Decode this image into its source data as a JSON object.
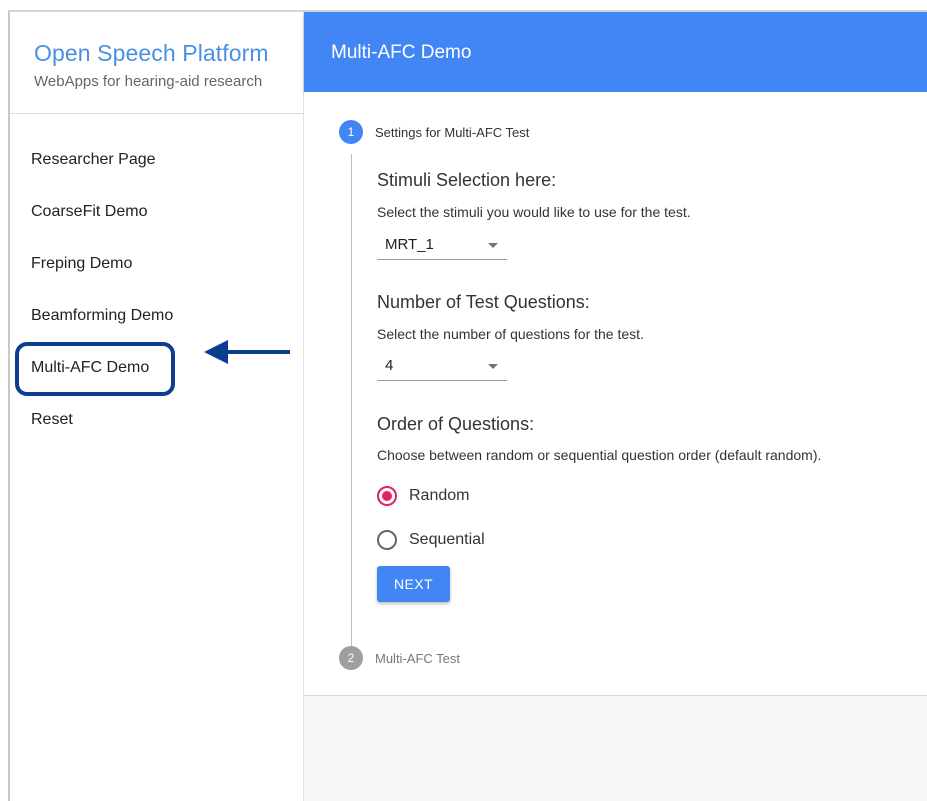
{
  "sidebar": {
    "title": "Open Speech Platform",
    "subtitle": "WebApps for hearing-aid research",
    "items": [
      {
        "label": "Researcher Page"
      },
      {
        "label": "CoarseFit Demo"
      },
      {
        "label": "Freping Demo"
      },
      {
        "label": "Beamforming Demo"
      },
      {
        "label": "Multi-AFC Demo"
      },
      {
        "label": "Reset"
      }
    ]
  },
  "header": {
    "title": "Multi-AFC Demo"
  },
  "stepper": {
    "steps": [
      {
        "number": "1",
        "label": "Settings for Multi-AFC Test"
      },
      {
        "number": "2",
        "label": "Multi-AFC Test"
      }
    ]
  },
  "stimuli": {
    "title": "Stimuli Selection here:",
    "description": "Select the stimuli you would like to use for the test.",
    "value": "MRT_1"
  },
  "questions": {
    "title": "Number of Test Questions:",
    "description": "Select the number of questions for the test.",
    "value": "4"
  },
  "order": {
    "title": "Order of Questions:",
    "description": "Choose between random or sequential question order (default random).",
    "options": [
      {
        "label": "Random",
        "checked": true
      },
      {
        "label": "Sequential",
        "checked": false
      }
    ]
  },
  "next_label": "NEXT",
  "colors": {
    "accent": "#4285f4",
    "radio": "#e0245e",
    "annotation": "#0d3d91",
    "brand": "#4a90e2"
  }
}
